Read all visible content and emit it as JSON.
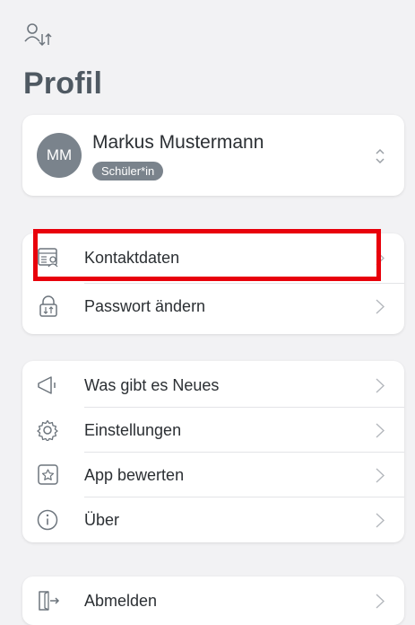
{
  "page": {
    "title": "Profil"
  },
  "profile": {
    "initials": "MM",
    "name": "Markus Mustermann",
    "role": "Schüler*in"
  },
  "groups": {
    "account": [
      {
        "label": "Kontaktdaten",
        "icon": "contact-card-icon"
      },
      {
        "label": "Passwort ändern",
        "icon": "lock-icon"
      }
    ],
    "general": [
      {
        "label": "Was gibt es Neues",
        "icon": "megaphone-icon"
      },
      {
        "label": "Einstellungen",
        "icon": "gear-icon"
      },
      {
        "label": "App bewerten",
        "icon": "star-icon"
      },
      {
        "label": "Über",
        "icon": "info-icon"
      }
    ],
    "session": [
      {
        "label": "Abmelden",
        "icon": "logout-icon"
      }
    ]
  },
  "colors": {
    "accent_text": "#4f5962",
    "icon": "#6d757d",
    "highlight": "#e8000b",
    "avatar": "#7a838c"
  }
}
